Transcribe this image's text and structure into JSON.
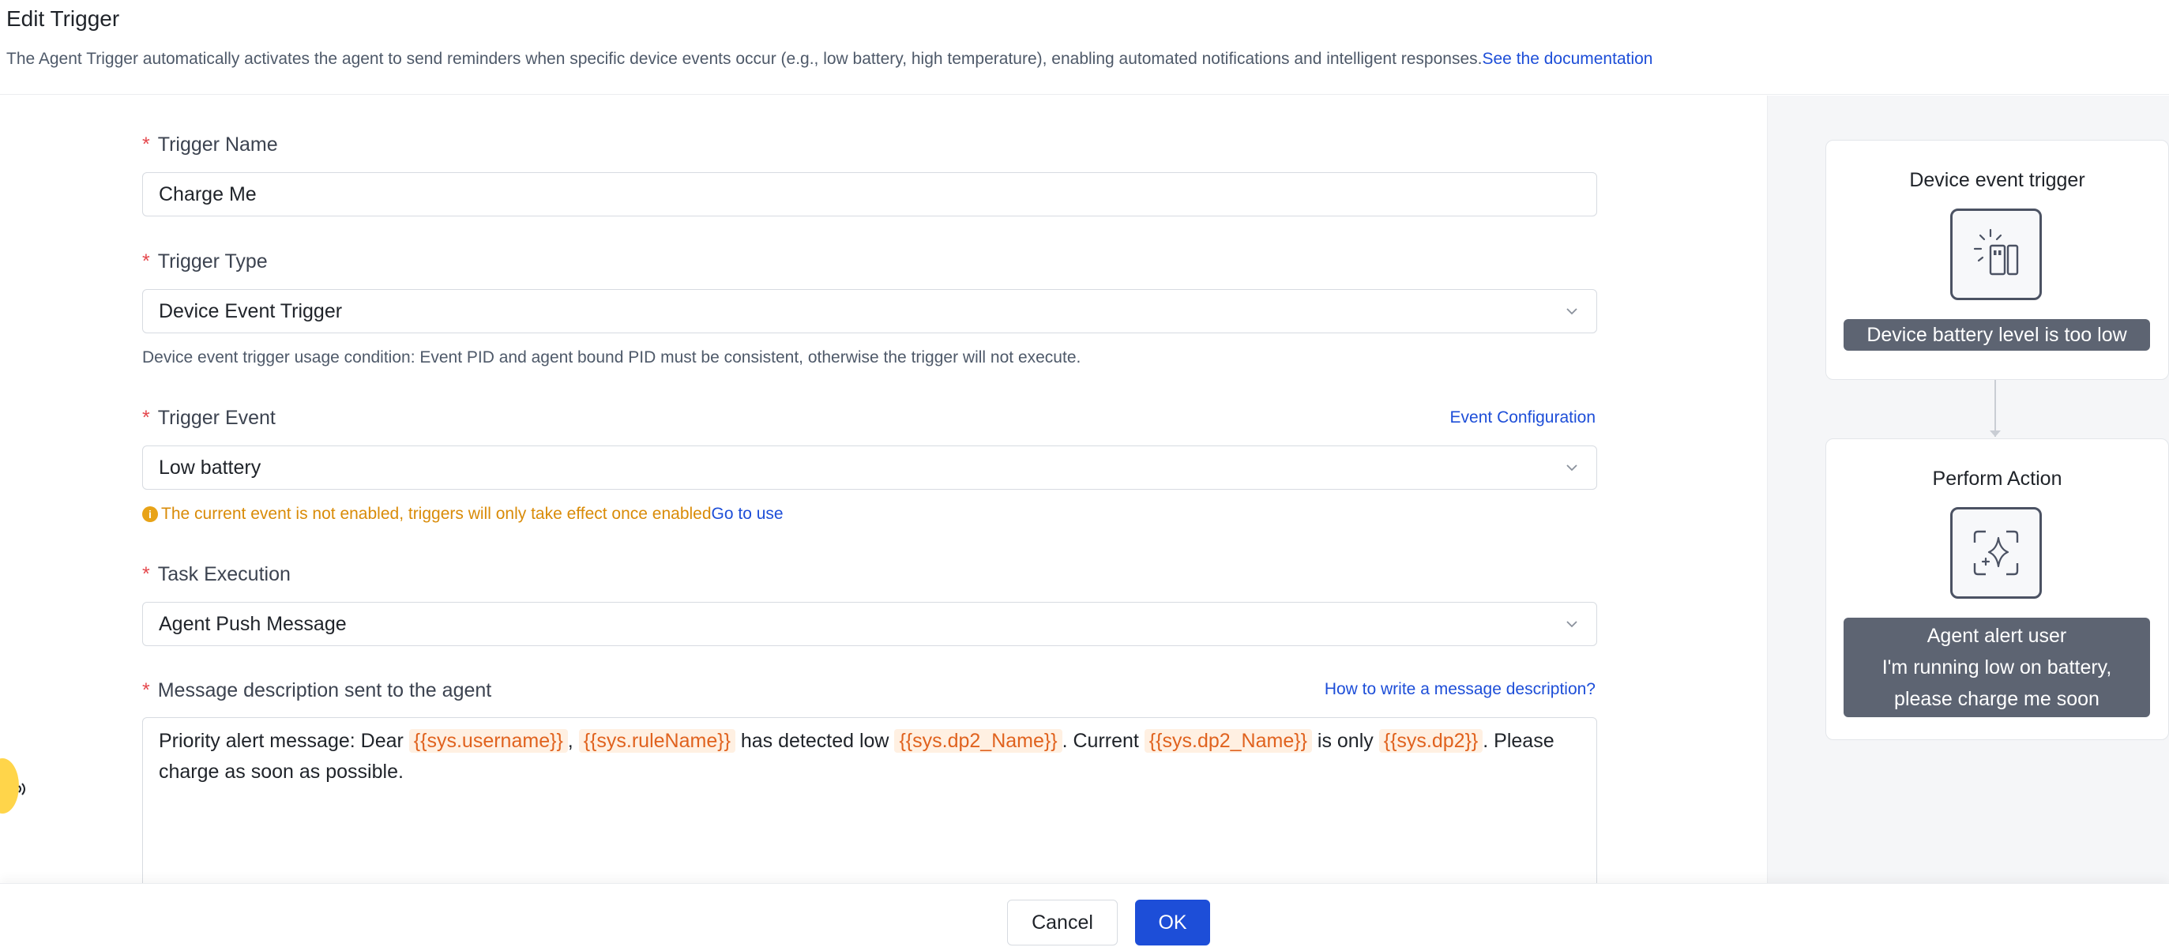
{
  "header": {
    "title": "Edit Trigger",
    "description": "The Agent Trigger automatically activates the agent to send reminders when specific device events occur (e.g., low battery, high temperature), enabling automated notifications and intelligent responses.",
    "doc_link": "See the documentation"
  },
  "form": {
    "required_mark": "*",
    "trigger_name": {
      "label": "Trigger Name",
      "value": "Charge Me"
    },
    "trigger_type": {
      "label": "Trigger Type",
      "value": "Device Event Trigger",
      "hint": "Device event trigger usage condition: Event PID and agent bound PID must be consistent, otherwise the trigger will not execute."
    },
    "trigger_event": {
      "label": "Trigger Event",
      "config_link": "Event Configuration",
      "value": "Low battery",
      "warning_icon": "i",
      "warning": "The current event is not enabled, triggers will only take effect once enabled",
      "warning_link": "Go to use"
    },
    "task_execution": {
      "label": "Task Execution",
      "value": "Agent Push Message"
    },
    "message": {
      "label": "Message description sent to the agent",
      "help_link": "How to write a message description?",
      "parts": {
        "t1": "Priority alert message: Dear ",
        "v1": "{{sys.username}}",
        "t2": ", ",
        "v2": "{{sys.ruleName}}",
        "t3": " has detected low ",
        "v3": "{{sys.dp2_Name}}",
        "t4": ". Current ",
        "v4": "{{sys.dp2_Name}}",
        "t5": " is only ",
        "v5": "{{sys.dp2}}",
        "t6": ". Please charge as soon as possible."
      }
    }
  },
  "sidebar": {
    "trigger_card": {
      "title": "Device event trigger",
      "icon": "device-event-icon",
      "caption": "Device battery level is too low"
    },
    "action_card": {
      "title": "Perform Action",
      "icon": "ai-sparkle-icon",
      "caption_line1": "Agent alert user",
      "caption_line2": "I'm running low on battery,",
      "caption_line3": "please charge me soon"
    }
  },
  "footer": {
    "cancel_label": "Cancel",
    "ok_label": "OK"
  },
  "colors": {
    "primary": "#1d4ed8",
    "required": "#e5484d",
    "warning": "#d98b08",
    "variable_text": "#e0621e",
    "variable_bg": "#fff0e2"
  }
}
